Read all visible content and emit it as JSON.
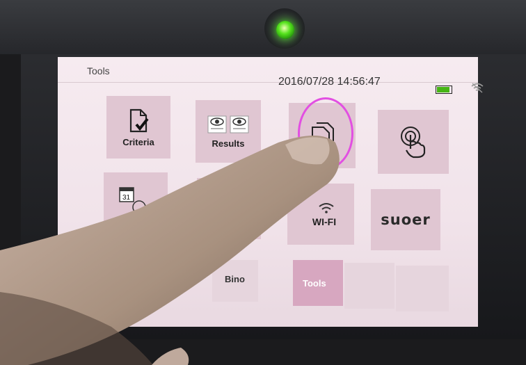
{
  "device": {
    "led_color": "#55e21d",
    "accent_color": "#e0c6d2",
    "annotation_color": "#e24fe2"
  },
  "header": {
    "title": "Tools",
    "datetime": "2016/07/28 14:56:47",
    "battery_level": 0.9,
    "battery_icon": "battery-icon",
    "wifi_icon": "wifi-icon"
  },
  "tiles": [
    {
      "label": "Criteria",
      "icon": "document-check-icon"
    },
    {
      "label": "Results",
      "icon": "eyes-icon"
    },
    {
      "label": "",
      "icon": "document-transfer-icon"
    },
    {
      "label": "",
      "icon": "touch-icon"
    },
    {
      "label": "",
      "icon": "calendar-clock-icon"
    },
    {
      "label": "",
      "icon": "blank-tile"
    },
    {
      "label": "WI-FI",
      "icon": "wifi-icon"
    },
    {
      "label": "suoer",
      "icon": "brand-logo"
    }
  ],
  "tabs": [
    {
      "label": "Bino",
      "selected": false
    },
    {
      "label": "Tools",
      "selected": true
    },
    {
      "label": "",
      "selected": false
    },
    {
      "label": "",
      "selected": false
    }
  ]
}
